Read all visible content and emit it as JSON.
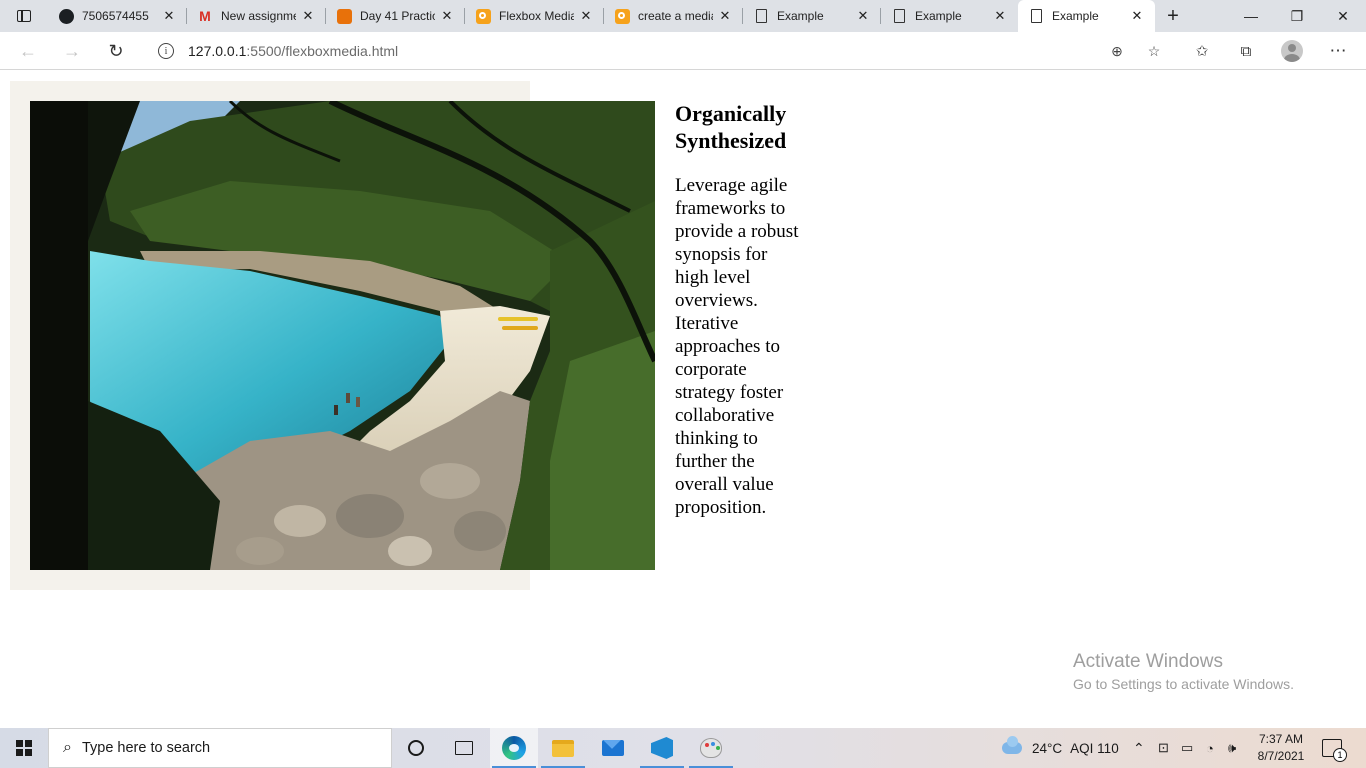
{
  "browser": {
    "tabs": [
      {
        "title": "7506574455",
        "favicon": "github-icon",
        "active": false
      },
      {
        "title": "New assignment",
        "favicon": "gmail-icon",
        "active": false
      },
      {
        "title": "Day 41 Practice",
        "favicon": "orange-box-icon",
        "active": false
      },
      {
        "title": "Flexbox Media",
        "favicon": "search-app-icon",
        "active": false
      },
      {
        "title": "create a media",
        "favicon": "search-app-icon",
        "active": false
      },
      {
        "title": "Example",
        "favicon": "page-icon",
        "active": false
      },
      {
        "title": "Example",
        "favicon": "page-icon",
        "active": false
      },
      {
        "title": "Example",
        "favicon": "page-icon",
        "active": true
      }
    ],
    "address": {
      "host": "127.0.0.1",
      "path": ":5500/flexboxmedia.html"
    }
  },
  "page": {
    "media": {
      "image_alt": "Beach cove with turquoise water framed by trees",
      "heading": "Organically Synthesized",
      "body": "Leverage agile frameworks to provide a robust synopsis for high level overviews. Iterative approaches to corporate strategy foster collaborative thinking to further the overall value proposition."
    },
    "watermark": {
      "title": "Activate Windows",
      "subtitle": "Go to Settings to activate Windows."
    }
  },
  "taskbar": {
    "search_placeholder": "Type here to search",
    "weather": "24°C",
    "aqi": "AQI 110",
    "time": "7:37 AM",
    "date": "8/7/2021",
    "notification_count": "1"
  }
}
